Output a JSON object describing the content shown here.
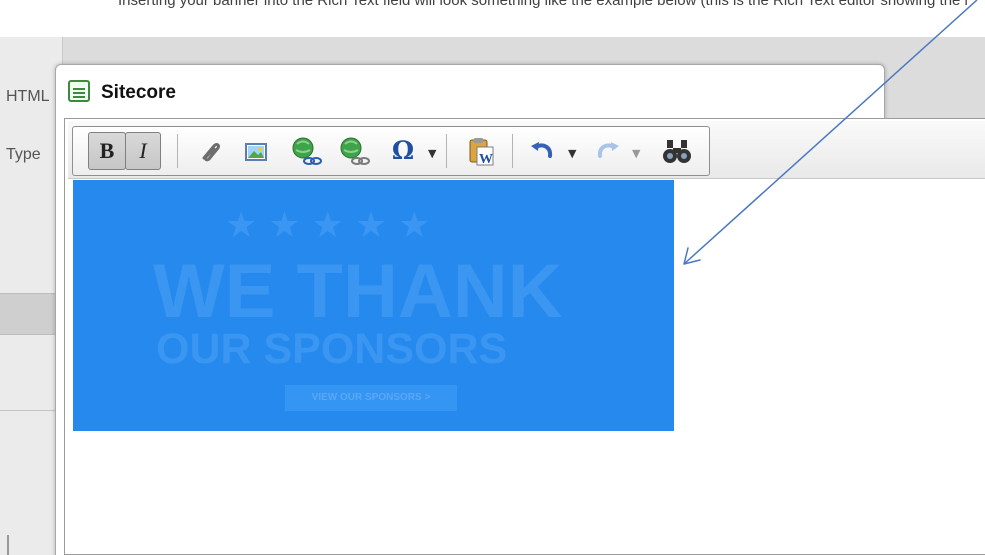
{
  "page_top_caption": "Inserting your banner into the Rich Text field will look something like the example below (this is the Rich Text editor showing the image).",
  "background": {
    "label_html": "HTML",
    "label_type": "Type"
  },
  "dialog": {
    "title": "Sitecore",
    "title_icon": "window-icon"
  },
  "toolbar": {
    "bold": "B",
    "italic": "I",
    "link_icon": "paperclip-icon",
    "image_icon": "insert-image-icon",
    "sitecore_link_icon": "globe-link-icon",
    "remove_link_icon": "globe-unlink-icon",
    "symbol": "Ω",
    "paste_icon": "paste-from-word-icon",
    "undo_icon": "undo-icon",
    "redo_icon": "redo-icon",
    "find_icon": "binoculars-icon"
  },
  "banner": {
    "stars": "★★★★★",
    "line1": "WE THANK",
    "line2": "OUR SPONSORS",
    "button": "VIEW OUR SPONSORS  >"
  },
  "colors": {
    "banner_bg": "#2589ee",
    "banner_text": "#3b96f2",
    "annotation_arrow": "#4a78c2"
  }
}
